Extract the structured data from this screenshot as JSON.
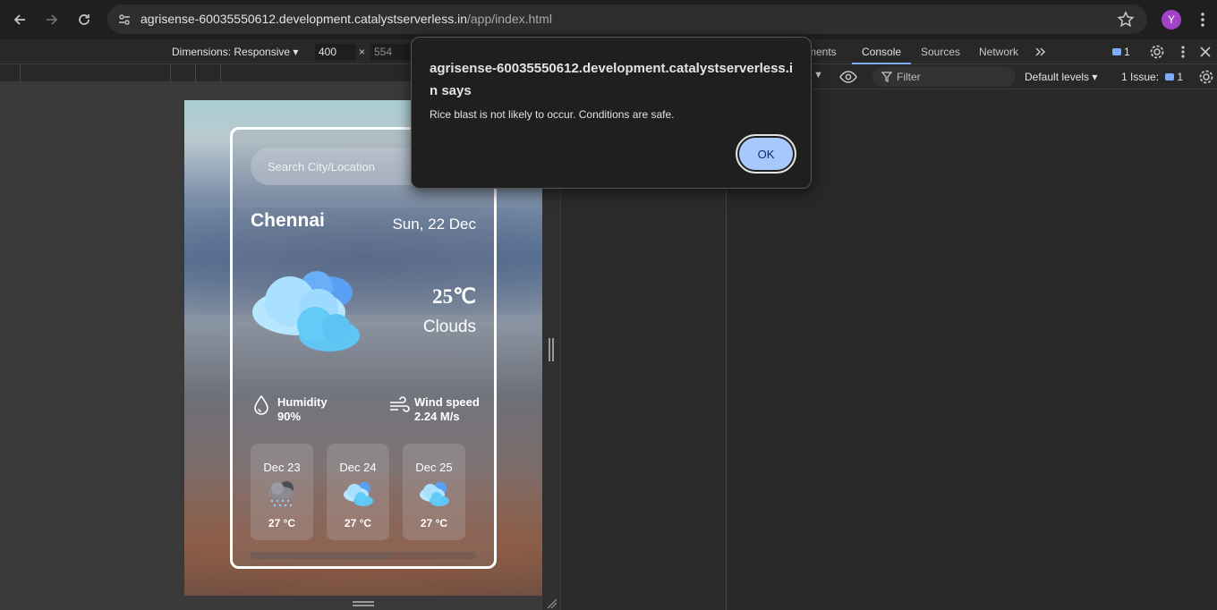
{
  "browser": {
    "url_host": "agrisense-60035550612.development.catalystserverless.in",
    "url_path": "/app/index.html",
    "profile_initial": "Y"
  },
  "device_toolbar": {
    "dimensions_label": "Dimensions: Responsive",
    "width_value": "400",
    "height_value": "554",
    "times": "×"
  },
  "app": {
    "search_placeholder": "Search City/Location",
    "city": "Chennai",
    "date": "Sun, 22 Dec",
    "temperature": "25℃",
    "condition": "Clouds",
    "humidity_label": "Humidity",
    "humidity_value": "90%",
    "wind_label": "Wind speed",
    "wind_value": "2.24 M/s",
    "forecast": [
      {
        "date": "Dec 23",
        "icon": "rain-cloud-icon",
        "temp": "27 °C"
      },
      {
        "date": "Dec 24",
        "icon": "clouds-icon",
        "temp": "27 °C"
      },
      {
        "date": "Dec 25",
        "icon": "clouds-icon",
        "temp": "27 °C"
      }
    ]
  },
  "devtools": {
    "tabs": [
      "ments",
      "Console",
      "Sources",
      "Network"
    ],
    "active_tab": "Console",
    "message_count": "1",
    "filter_placeholder": "Filter",
    "levels_label": "Default levels",
    "issues_label": "1 Issue:",
    "issues_count": "1"
  },
  "dialog": {
    "title": "agrisense-60035550612.development.catalystserverless.in says",
    "message": "Rice blast is not likely to occur. Conditions are safe.",
    "ok_label": "OK"
  },
  "colors": {
    "accent": "#7cacf8",
    "ok_button": "#a8c7fa",
    "avatar": "#a142c7"
  }
}
